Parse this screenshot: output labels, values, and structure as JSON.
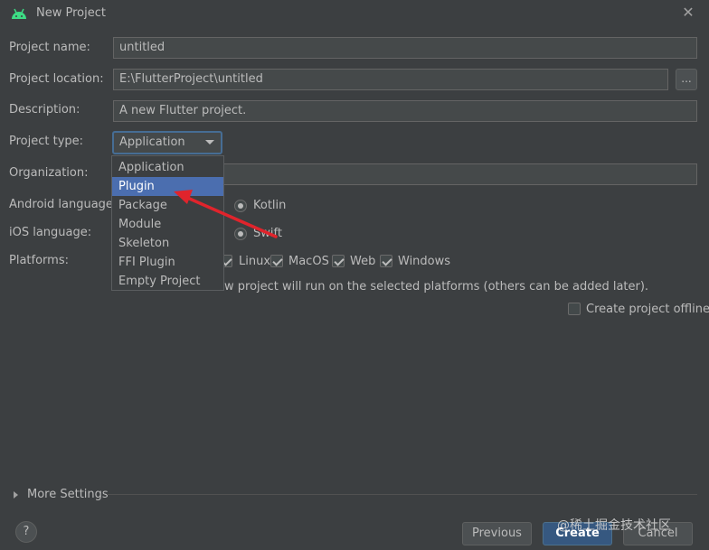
{
  "window": {
    "title": "New Project",
    "close_glyph": "✕",
    "icon": "android-icon"
  },
  "form": {
    "project_name": {
      "label": "Project name:",
      "value": "untitled"
    },
    "project_location": {
      "label": "Project location:",
      "value": "E:\\FlutterProject\\untitled",
      "browse_label": "..."
    },
    "description": {
      "label": "Description:",
      "value": "A new Flutter project."
    },
    "project_type": {
      "label": "Project type:",
      "value": "Application"
    },
    "organization": {
      "label": "Organization:",
      "value": ""
    },
    "android_language": {
      "label": "Android language:",
      "selected": "Kotlin"
    },
    "ios_language": {
      "label": "iOS language:",
      "selected": "Swift"
    },
    "platforms": {
      "label": "Platforms:",
      "items": [
        {
          "name": "Linux",
          "checked": true
        },
        {
          "name": "MacOS",
          "checked": true
        },
        {
          "name": "Web",
          "checked": true
        },
        {
          "name": "Windows",
          "checked": true
        }
      ],
      "note": "w project will run on the selected platforms (others can be added later)."
    },
    "offline": {
      "label": "Create project offline",
      "checked": false
    }
  },
  "dropdown": {
    "options": [
      "Application",
      "Plugin",
      "Package",
      "Module",
      "Skeleton",
      "FFI Plugin",
      "Empty Project"
    ],
    "highlighted": "Plugin"
  },
  "more_settings": {
    "label": "More Settings"
  },
  "footer": {
    "help_label": "?",
    "previous_label": "Previous",
    "create_label": "Create",
    "cancel_label": "Cancel",
    "watermark": "@稀土掘金技术社区"
  },
  "colors": {
    "background": "#3c3f41",
    "field": "#45494a",
    "selection": "#4b6eaf",
    "focus_border": "#466d94",
    "annotation_arrow": "#e0242c",
    "android_green": "#3ddc84"
  }
}
